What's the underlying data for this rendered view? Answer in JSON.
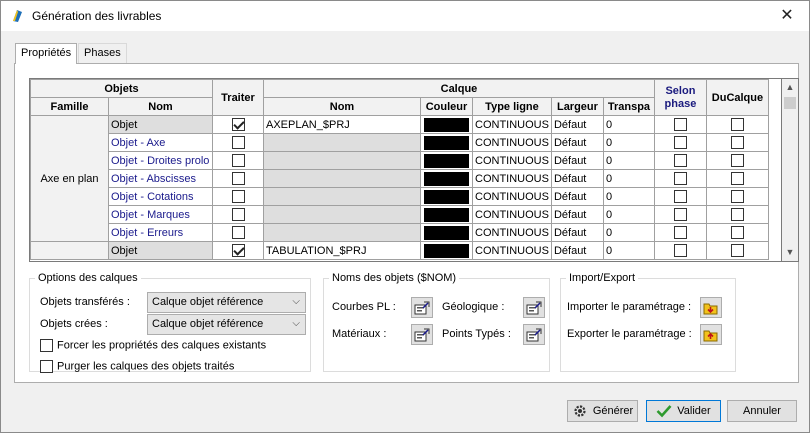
{
  "window": {
    "title": "Génération des livrables",
    "close_glyph": "✕"
  },
  "tabs": [
    {
      "label": "Propriétés"
    },
    {
      "label": "Phases"
    }
  ],
  "grid": {
    "headers": {
      "objets": "Objets",
      "famille": "Famille",
      "nom": "Nom",
      "traiter": "Traiter",
      "calque": "Calque",
      "calque_nom": "Nom",
      "couleur": "Couleur",
      "type_ligne": "Type ligne",
      "largeur": "Largeur",
      "transparence": "Transpa",
      "selon_phase": "Selon phase",
      "ducalque": "DuCalque"
    },
    "groups": [
      {
        "famille": "Axe en plan",
        "rows": [
          {
            "nom": "Objet",
            "traiter": true,
            "calque_nom": "AXEPLAN_$PRJ",
            "type_ligne": "CONTINUOUS",
            "largeur": "Défaut",
            "transparence": "0",
            "selon_phase": false,
            "ducalque": false
          },
          {
            "nom": "Objet - Axe",
            "traiter": false,
            "calque_nom": "",
            "type_ligne": "CONTINUOUS",
            "largeur": "Défaut",
            "transparence": "0",
            "selon_phase": false,
            "ducalque": false
          },
          {
            "nom": "Objet - Droites prolo",
            "traiter": false,
            "calque_nom": "",
            "type_ligne": "CONTINUOUS",
            "largeur": "Défaut",
            "transparence": "0",
            "selon_phase": false,
            "ducalque": false
          },
          {
            "nom": "Objet - Abscisses",
            "traiter": false,
            "calque_nom": "",
            "type_ligne": "CONTINUOUS",
            "largeur": "Défaut",
            "transparence": "0",
            "selon_phase": false,
            "ducalque": false
          },
          {
            "nom": "Objet - Cotations",
            "traiter": false,
            "calque_nom": "",
            "type_ligne": "CONTINUOUS",
            "largeur": "Défaut",
            "transparence": "0",
            "selon_phase": false,
            "ducalque": false
          },
          {
            "nom": "Objet - Marques",
            "traiter": false,
            "calque_nom": "",
            "type_ligne": "CONTINUOUS",
            "largeur": "Défaut",
            "transparence": "0",
            "selon_phase": false,
            "ducalque": false
          },
          {
            "nom": "Objet - Erreurs",
            "traiter": false,
            "calque_nom": "",
            "type_ligne": "CONTINUOUS",
            "largeur": "Défaut",
            "transparence": "0",
            "selon_phase": false,
            "ducalque": false
          }
        ]
      },
      {
        "famille": "",
        "rows": [
          {
            "nom": "Objet",
            "traiter": true,
            "calque_nom": "TABULATION_$PRJ",
            "type_ligne": "CONTINUOUS",
            "largeur": "Défaut",
            "transparence": "0",
            "selon_phase": false,
            "ducalque": false
          }
        ]
      }
    ],
    "swatch_color": "#000000"
  },
  "options": {
    "legend": "Options des calques",
    "transferes_label": "Objets transférés :",
    "transferes_value": "Calque objet référence",
    "crees_label": "Objets crées :",
    "crees_value": "Calque objet référence",
    "forcer_label": "Forcer les propriétés des calques existants",
    "forcer_checked": false,
    "purger_label": "Purger les calques des objets traités",
    "purger_checked": false
  },
  "noms": {
    "legend": "Noms des objets ($NOM)",
    "courbes_label": "Courbes PL :",
    "geologique_label": "Géologique :",
    "materiaux_label": "Matériaux :",
    "points_label": "Points Typés :"
  },
  "import_export": {
    "legend": "Import/Export",
    "importer_label": "Importer le paramétrage :",
    "exporter_label": "Exporter le paramétrage :"
  },
  "buttons": {
    "generer": "Générer",
    "valider": "Valider",
    "annuler": "Annuler"
  },
  "colors": {
    "accent": "#0078d7",
    "link_text": "#1a1a8c",
    "check_green": "#2e9a2e"
  }
}
